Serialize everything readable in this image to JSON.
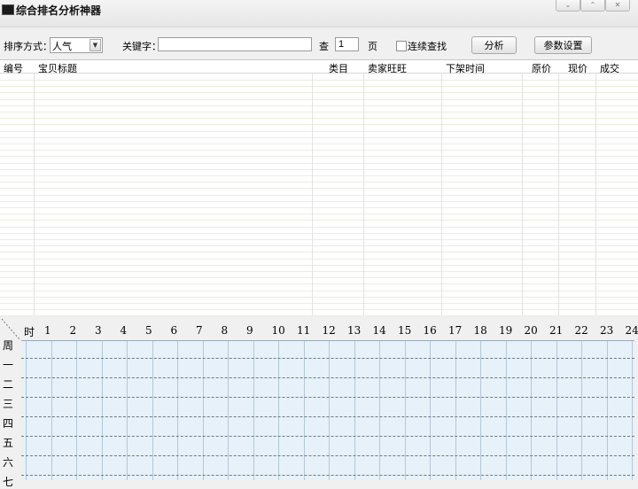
{
  "window": {
    "title": "综合排名分析神器",
    "buttons": {
      "minimize": "⌄",
      "maximize": "⌃",
      "close": "✕"
    }
  },
  "toolbar": {
    "sort_label": "排序方式：",
    "sort_value": "人气",
    "keyword_label": "关键字：",
    "keyword_value": "",
    "search_label": "查",
    "page_value": "1",
    "page_unit": "页",
    "continuous_label": "连续查找",
    "continuous_checked": false,
    "analyze_button": "分析",
    "settings_button": "参数设置"
  },
  "table": {
    "columns": [
      "编号",
      "宝贝标题",
      "类目",
      "卖家旺旺",
      "下架时间",
      "原价",
      "现价",
      "成交"
    ],
    "rows": []
  },
  "schedule": {
    "corner_label": "时",
    "hours": [
      "1",
      "2",
      "3",
      "4",
      "5",
      "6",
      "7",
      "8",
      "9",
      "10",
      "11",
      "12",
      "13",
      "14",
      "15",
      "16",
      "17",
      "18",
      "19",
      "20",
      "21",
      "22",
      "23",
      "24"
    ],
    "days": [
      "周",
      "一",
      "二",
      "三",
      "四",
      "五",
      "六",
      "七"
    ]
  }
}
